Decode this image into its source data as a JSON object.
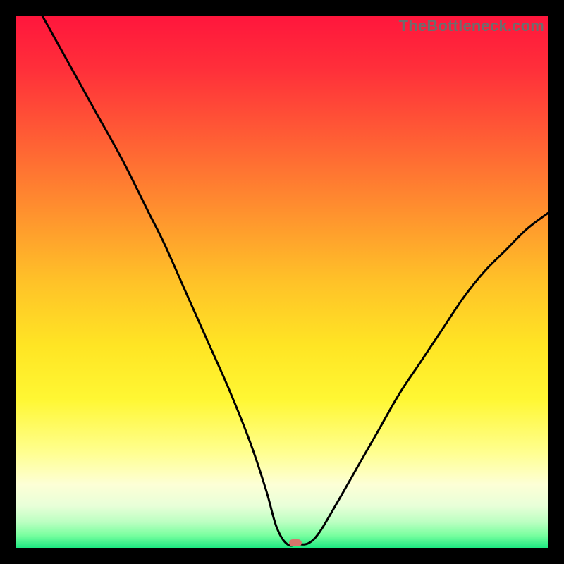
{
  "watermark": {
    "text": "TheBottleneck.com"
  },
  "gradient": {
    "stops": [
      {
        "offset": 0.0,
        "color": "#ff163c"
      },
      {
        "offset": 0.1,
        "color": "#ff2f3a"
      },
      {
        "offset": 0.22,
        "color": "#ff5a35"
      },
      {
        "offset": 0.35,
        "color": "#ff8a2f"
      },
      {
        "offset": 0.5,
        "color": "#ffc228"
      },
      {
        "offset": 0.62,
        "color": "#ffe524"
      },
      {
        "offset": 0.72,
        "color": "#fff733"
      },
      {
        "offset": 0.82,
        "color": "#ffff90"
      },
      {
        "offset": 0.88,
        "color": "#fdffd6"
      },
      {
        "offset": 0.92,
        "color": "#e8ffd8"
      },
      {
        "offset": 0.95,
        "color": "#bcffc2"
      },
      {
        "offset": 0.975,
        "color": "#7affa0"
      },
      {
        "offset": 1.0,
        "color": "#19e880"
      }
    ]
  },
  "marker": {
    "x_pct": 52.5,
    "y_pct": 98.9,
    "color": "#d9746b"
  },
  "chart_data": {
    "type": "line",
    "title": "",
    "xlabel": "",
    "ylabel": "",
    "xlim": [
      0,
      100
    ],
    "ylim": [
      0,
      100
    ],
    "series": [
      {
        "name": "bottleneck-curve",
        "x": [
          5,
          10,
          15,
          20,
          25,
          28,
          32,
          36,
          40,
          44,
          47,
          49,
          51,
          53,
          55,
          57,
          60,
          64,
          68,
          72,
          76,
          80,
          84,
          88,
          92,
          96,
          100
        ],
        "y": [
          100,
          91,
          82,
          73,
          63,
          57,
          48,
          39,
          30,
          20,
          11,
          4,
          0.8,
          0.8,
          1.0,
          3,
          8,
          15,
          22,
          29,
          35,
          41,
          47,
          52,
          56,
          60,
          63
        ]
      }
    ],
    "annotations": [
      {
        "type": "marker",
        "x": 52.5,
        "y": 1.1,
        "label": "optimal-point"
      }
    ]
  }
}
